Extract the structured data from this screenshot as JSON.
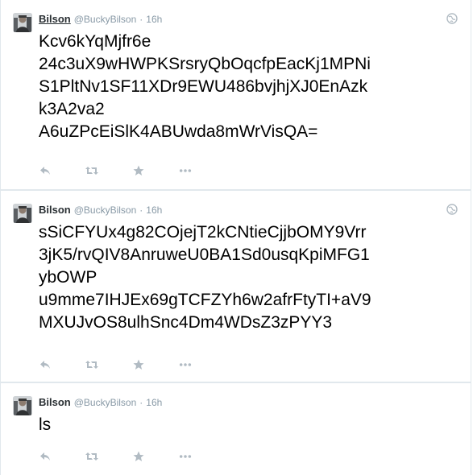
{
  "colors": {
    "name": "#292f33",
    "meta": "#8899a6",
    "icon": "#b1bbc3",
    "border": "#e1e8ed",
    "text": "#000000"
  },
  "tweets": [
    {
      "name": "Bilson",
      "handle": "@BuckyBilson",
      "separator": "·",
      "time": "16h",
      "text": "Kcv6kYqMjfr6e\n24c3uX9wHWPKSrsryQbOqcfpEacKj1MPNi\nS1PltNv1SF11XDr9EWU486bvjhjXJ0EnAzk\nk3A2va2\nA6uZPcEiSlK4ABUwda8mWrVisQA="
    },
    {
      "name": "Bilson",
      "handle": "@BuckyBilson",
      "separator": "·",
      "time": "16h",
      "text": "sSiCFYUx4g82COjejT2kCNtieCjjbOMY9Vrr\n3jK5/rvQIV8AnruweU0BA1Sd0usqKpiMFG1\nybOWP\nu9mme7IHJEx69gTCFZYh6w2afrFtyTI+aV9\nMXUJvOS8ulhSnc4Dm4WDsZ3zPYY3"
    },
    {
      "name": "Bilson",
      "handle": "@BuckyBilson",
      "separator": "·",
      "time": "16h",
      "text": "ls"
    }
  ],
  "icons": [
    "reply-icon",
    "retweet-icon",
    "favorite-icon",
    "more-icon",
    "globe-icon"
  ]
}
